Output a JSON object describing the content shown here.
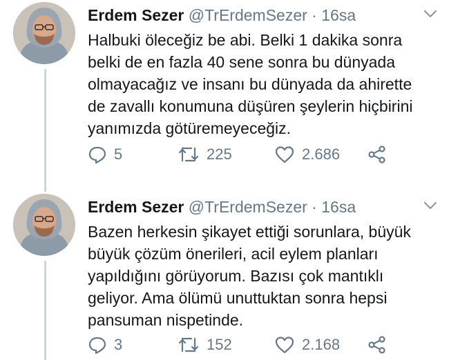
{
  "tweets": [
    {
      "name": "Erdem Sezer",
      "handle": "@TrErdemSezer",
      "dot": "·",
      "time": "16sa",
      "lines": [
        "Halbuki öleceğiz be abi. Belki 1 dakika sonra",
        "belki de en fazla 40 sene sonra bu dünyada",
        "olmayacağız ve insanı bu dünyada da ahirette",
        "de zavallı konumuna düşüren şeylerin hiçbirini",
        "yanımızda götüremeyeceğiz."
      ],
      "replies": "5",
      "retweets": "225",
      "likes": "2.686"
    },
    {
      "name": "Erdem Sezer",
      "handle": "@TrErdemSezer",
      "dot": "·",
      "time": "16sa",
      "lines": [
        "Bazen herkesin şikayet ettiği sorunlara, büyük",
        "büyük çözüm önerileri, acil eylem planları",
        "yapıldığını görüyorum. Bazısı çok mantıklı",
        "geliyor. Ama ölümü unuttuktan sonra hepsi",
        "pansuman nispetinde."
      ],
      "replies": "3",
      "retweets": "152",
      "likes": "2.168"
    }
  ],
  "colors": {
    "muted": "#657786",
    "text": "#14171a",
    "thread_line": "#ccd6dd"
  },
  "icons": [
    "reply-icon",
    "retweet-icon",
    "like-icon",
    "share-icon",
    "chevron-down-icon"
  ]
}
